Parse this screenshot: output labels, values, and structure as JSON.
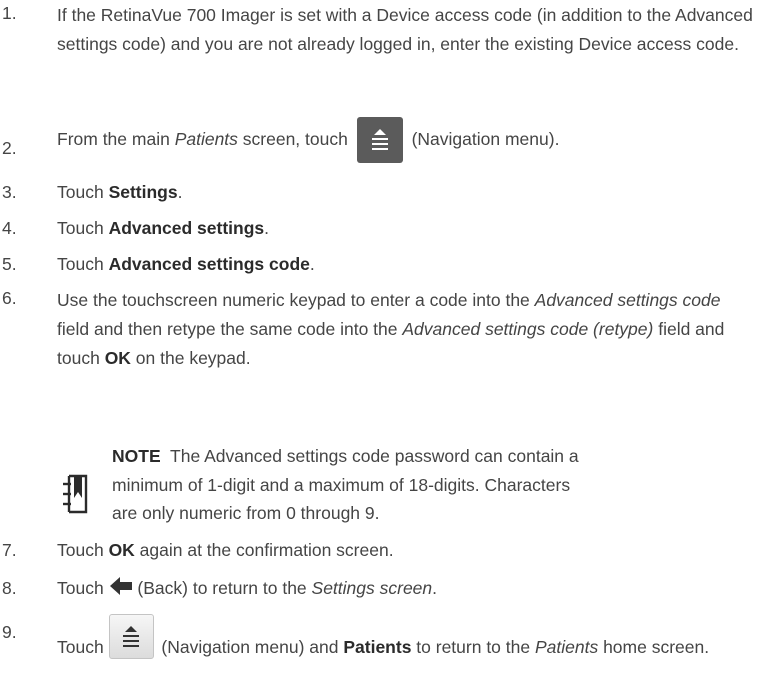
{
  "steps": [
    {
      "num": "1.",
      "text": "If the RetinaVue 700 Imager is set with a Device access code (in addition to the Advanced settings code) and you are not already logged in, enter the existing Device access code."
    },
    {
      "num": "2.",
      "pre": "From the main ",
      "em": "Patients",
      "mid": " screen, touch ",
      "post": " (Navigation menu)."
    },
    {
      "num": "3.",
      "pre": "Touch ",
      "bold": "Settings",
      "post": "."
    },
    {
      "num": "4.",
      "pre": "Touch ",
      "bold": "Advanced settings",
      "post": "."
    },
    {
      "num": "5.",
      "pre": "Touch ",
      "bold": "Advanced settings code",
      "post": "."
    },
    {
      "num": "6.",
      "t1": "Use the touchscreen numeric keypad to enter a code into the ",
      "e1": "Advanced settings code",
      "t2": " field and then retype the same code into the ",
      "e2": "Advanced settings code (retype)",
      "t3": " field and touch ",
      "b1": "OK",
      "t4": " on the keypad."
    },
    {
      "num": "7.",
      "pre": "Touch ",
      "bold": "OK",
      "post": " again at the confirmation screen."
    },
    {
      "num": "8.",
      "pre": "Touch ",
      "mid": " (Back) to return to the ",
      "em": "Settings screen",
      "post": "."
    },
    {
      "num": "9.",
      "pre": "Touch ",
      "mid": " (Navigation menu) and ",
      "bold": "Patients",
      "mid2": " to return to the ",
      "em": "Patients",
      "post": " home screen."
    }
  ],
  "note": {
    "label": "NOTE",
    "text": "The Advanced settings code password can contain a minimum of 1-digit and a maximum of 18-digits. Characters are only numeric from 0 through 9."
  },
  "icons": {
    "nav_dark": "navigation-menu-icon",
    "back": "back-arrow-icon",
    "nav_light": "navigation-menu-icon",
    "note": "note-book-icon"
  }
}
